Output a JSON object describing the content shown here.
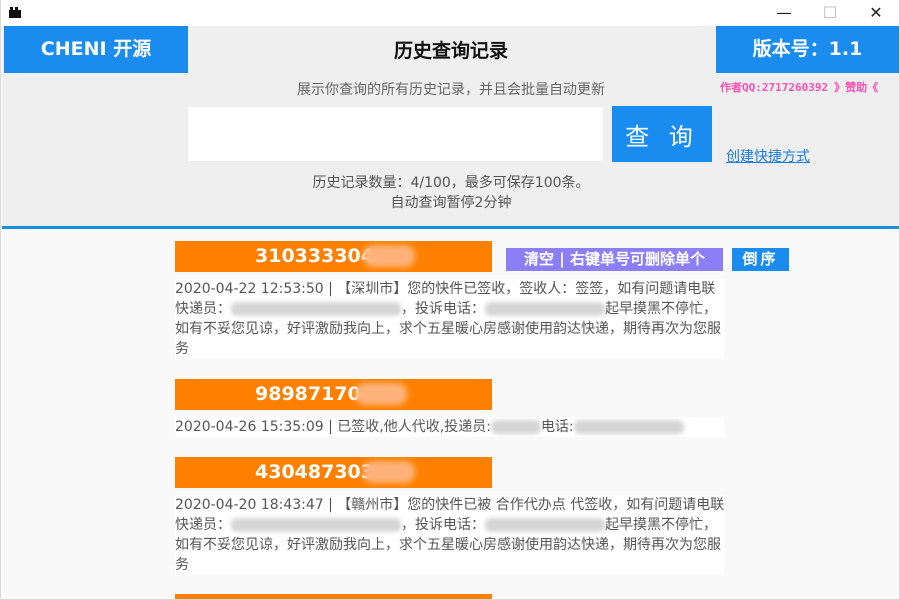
{
  "window": {
    "minimize": "—",
    "maximize": "☐",
    "close": "✕"
  },
  "header": {
    "brand": "CHENI 开源",
    "title": "历史查询记录",
    "version": "版本号：1.1",
    "subtitle": "展示你查询的所有历史记录，并且会批量自动更新",
    "author": "作者QQ:2717260392",
    "sponsor": "》赞助《",
    "search_value": "",
    "search_button": "查 询",
    "shortcut_link": "创建快捷方式",
    "count_line1": "历史记录数量：4/100，最多可保存100条。",
    "count_line2": "自动查询暂停2分钟"
  },
  "controls": {
    "clear": "清空 | 右键单号可删除单个",
    "reverse": "倒序"
  },
  "records": [
    {
      "number": "310333304",
      "detail_a": "2020-04-22 12:53:50 | 【深圳市】您的快件已签收，签收人：签签，如有问题请电联快递员：",
      "detail_b": "，投诉电话：",
      "detail_c": "起早摸黑不停忙，如有不妥您见谅，好评激励我向上，求个五星暖心房感谢使用韵达快递，期待再次为您服务"
    },
    {
      "number": "98987170",
      "detail_a": "2020-04-26 15:35:09 | 已签收,他人代收,投递员:",
      "detail_b": "电话:",
      "detail_c": ""
    },
    {
      "number": "430487303",
      "detail_a": "2020-04-20 18:43:47 | 【赣州市】您的快件已被 合作代办点 代签收，如有问题请电联快递员：",
      "detail_b": "，投诉电话：",
      "detail_c": "起早摸黑不停忙，如有不妥您见谅，好评激励我向上，求个五星暖心房感谢使用韵达快递，期待再次为您服务"
    }
  ]
}
